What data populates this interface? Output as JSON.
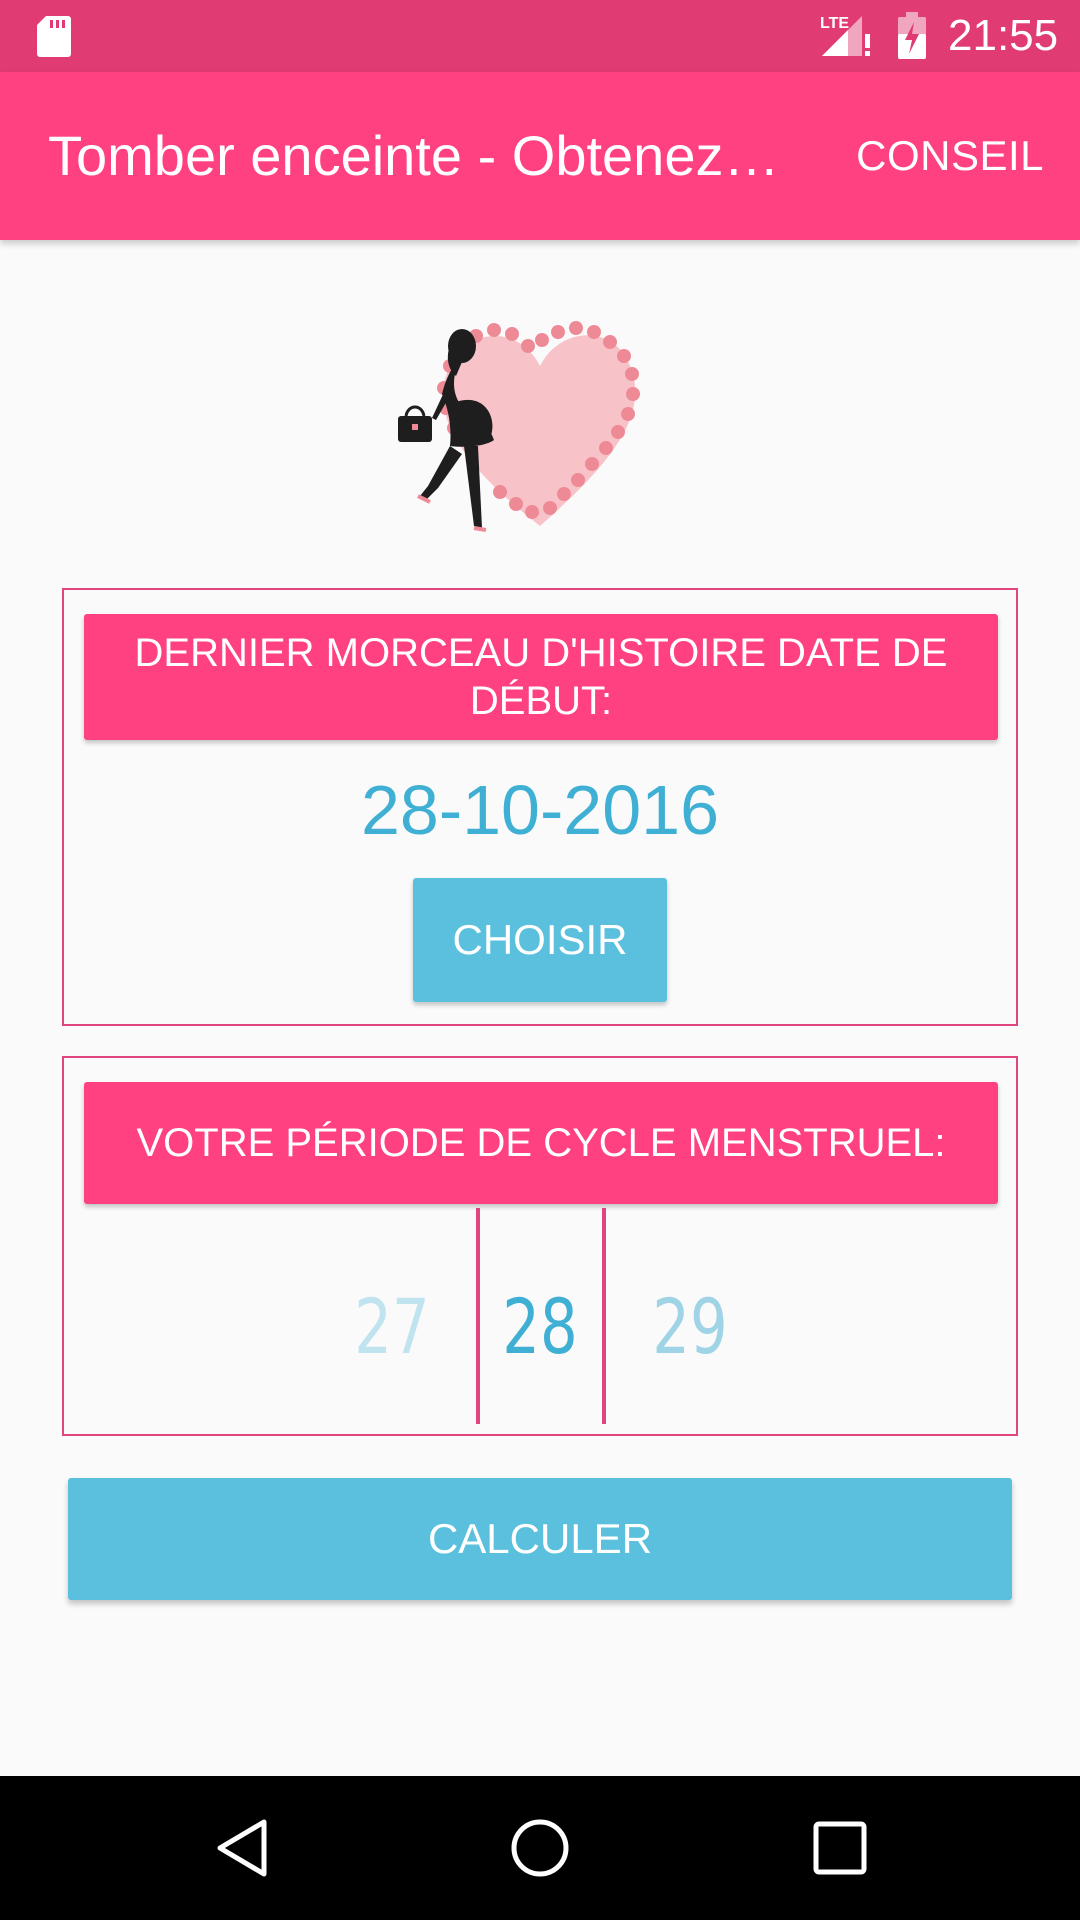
{
  "status_bar": {
    "time": "21:55",
    "network_label": "LTE",
    "icons": [
      "sd-card-icon",
      "signal-icon",
      "battery-charging-icon"
    ]
  },
  "app_bar": {
    "title": "Tomber enceinte - Obtenez…",
    "action_label": "CONSEIL"
  },
  "period_card": {
    "header": "DERNIER MORCEAU D'HISTOIRE DATE DE DÉBUT:",
    "date_value": "28-10-2016",
    "choose_button": "CHOISIR"
  },
  "cycle_card": {
    "header": "VOTRE PÉRIODE DE CYCLE MENSTRUEL:",
    "picker": {
      "previous": "27",
      "current": "28",
      "next": "29"
    }
  },
  "calculate_button": "CALCULER",
  "colors": {
    "status_bar": "#e03b73",
    "app_bar": "#ff4081",
    "accent_blue": "#5bc0de",
    "date_text": "#3fb0d3"
  },
  "nav_bar": {
    "icons": [
      "back-icon",
      "home-icon",
      "recents-icon"
    ]
  }
}
